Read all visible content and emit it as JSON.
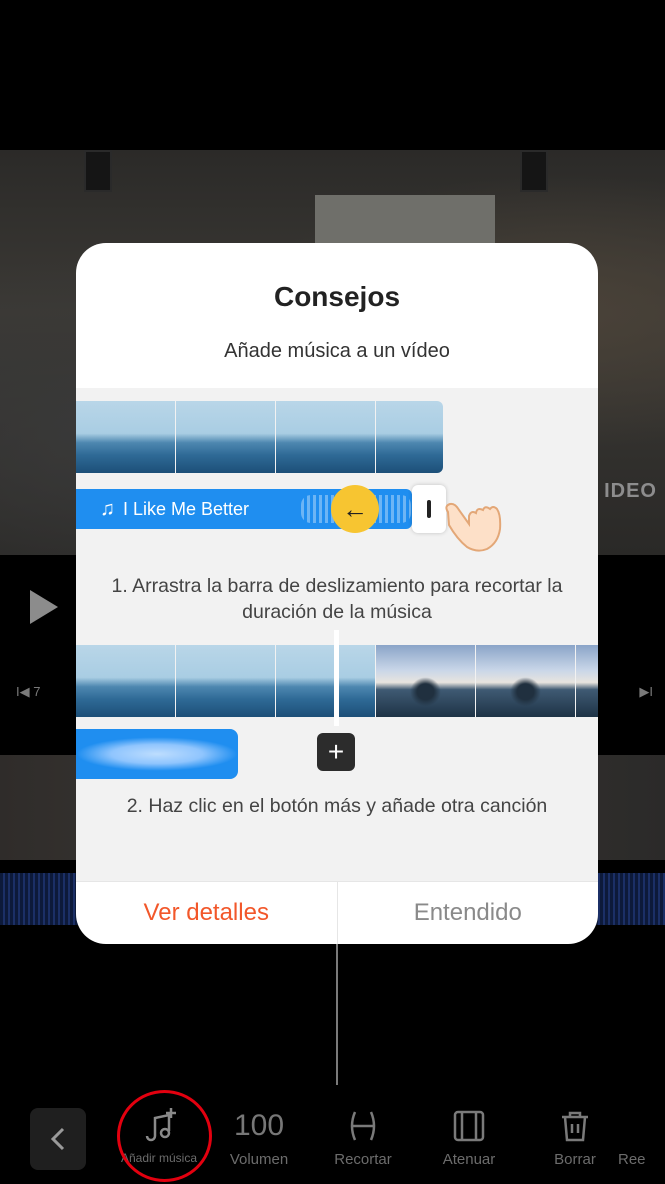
{
  "background": {
    "watermark": "IDEO",
    "skip_left_label": "I◀ 7",
    "skip_right_label": "▶I"
  },
  "modal": {
    "title": "Consejos",
    "subtitle": "Añade música a un vídeo",
    "music_track_name": "I Like Me Better",
    "step1": "1. Arrastra la barra de deslizamiento para recortar la duración de la música",
    "step2": "2. Haz clic en el botón más y añade otra canción",
    "details_button": "Ver detalles",
    "ok_button": "Entendido"
  },
  "toolbar": {
    "items": [
      {
        "label": "Añadir música",
        "icon": "add-music-icon"
      },
      {
        "label": "Volumen",
        "value": "100",
        "icon": "volume-value"
      },
      {
        "label": "Recortar",
        "icon": "trim-icon"
      },
      {
        "label": "Atenuar",
        "icon": "fade-icon"
      },
      {
        "label": "Borrar",
        "icon": "trash-icon"
      },
      {
        "label": "Ree"
      }
    ]
  },
  "colors": {
    "accent_blue": "#1f8ef0",
    "accent_orange": "#f2572a",
    "highlight_yellow": "#f7c531",
    "annotation_red": "#e3000f"
  }
}
